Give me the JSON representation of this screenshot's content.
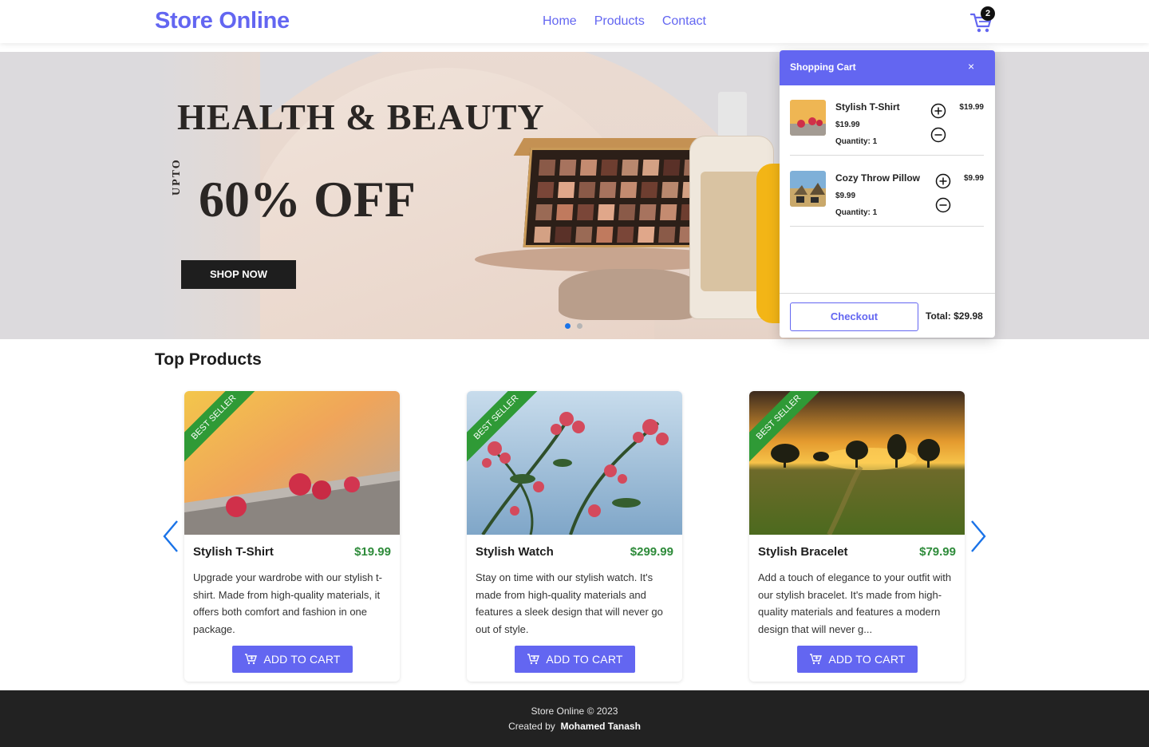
{
  "header": {
    "brand": "Store Online",
    "nav": [
      "Home",
      "Products",
      "Contact"
    ],
    "cart_count": "2"
  },
  "hero": {
    "title": "HEALTH & BEAUTY",
    "upto": "UPTO",
    "discount": "60% OFF",
    "cta": "SHOP NOW",
    "slide_count": 2,
    "active_slide": 1
  },
  "section": {
    "title": "Top Products"
  },
  "products": [
    {
      "name": "Stylish T-Shirt",
      "price": "$19.99",
      "ribbon": "BEST SELLER",
      "description": "Upgrade your wardrobe with our stylish t-shirt. Made from high-quality materials, it offers both comfort and fashion in one package.",
      "button": "ADD TO CART",
      "image": "raspberries"
    },
    {
      "name": "Stylish Watch",
      "price": "$299.99",
      "ribbon": "BEST SELLER",
      "description": "Stay on time with our stylish watch. It's made from high-quality materials and features a sleek design that will never go out of style.",
      "button": "ADD TO CART",
      "image": "flowers"
    },
    {
      "name": "Stylish Bracelet",
      "price": "$79.99",
      "ribbon": "BEST SELLER",
      "description": "Add a touch of elegance to your outfit with our stylish bracelet. It's made from high-quality materials and features a modern design that will never g...",
      "button": "ADD TO CART",
      "image": "sunset-field"
    }
  ],
  "cart": {
    "title": "Shopping Cart",
    "close": "×",
    "items": [
      {
        "name": "Stylish T-Shirt",
        "price": "$19.99",
        "quantity": "Quantity: 1",
        "line_total": "$19.99"
      },
      {
        "name": "Cozy Throw Pillow",
        "price": "$9.99",
        "quantity": "Quantity: 1",
        "line_total": "$9.99"
      }
    ],
    "checkout": "Checkout",
    "total": "Total:  $29.98"
  },
  "footer": {
    "line1": "Store Online © 2023",
    "created_by": "Created by",
    "author": "Mohamed Tanash"
  },
  "colors": {
    "accent": "#6366f1",
    "price_green": "#2e8b3a",
    "ribbon_green": "#2f9a36",
    "footer_bg": "#222222"
  }
}
